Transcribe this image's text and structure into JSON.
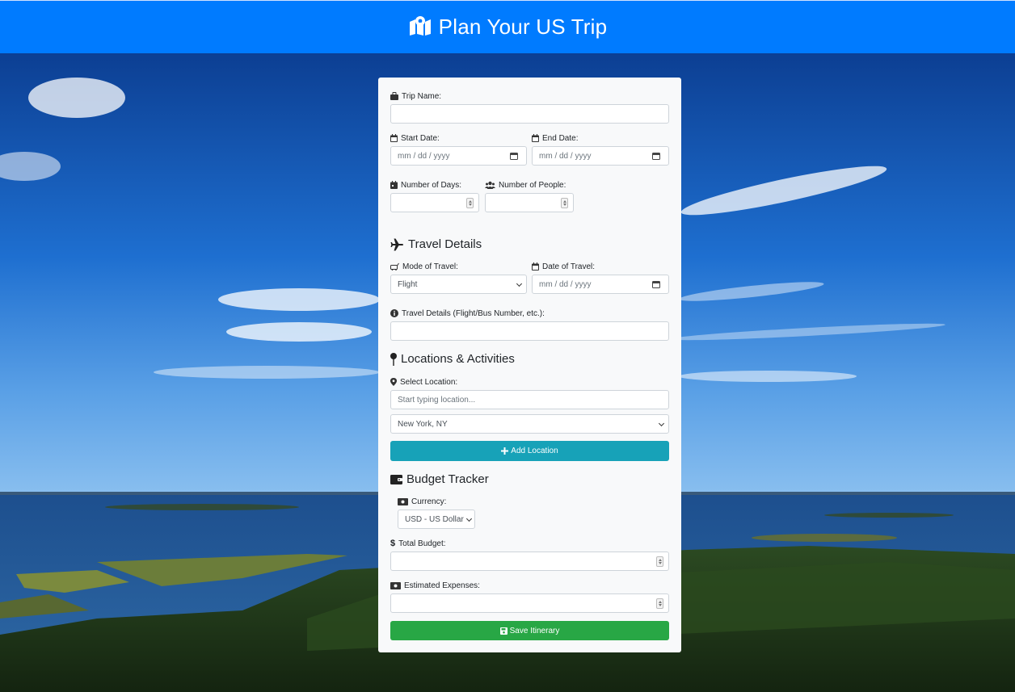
{
  "header": {
    "title": "Plan Your US Trip",
    "icon": "map-marked-icon"
  },
  "form": {
    "trip_name": {
      "label": "Trip Name:",
      "value": ""
    },
    "start_date": {
      "label": "Start Date:",
      "placeholder": "mm / dd / yyyy"
    },
    "end_date": {
      "label": "End Date:",
      "placeholder": "mm / dd / yyyy"
    },
    "num_days": {
      "label": "Number of Days:",
      "value": ""
    },
    "num_people": {
      "label": "Number of People:",
      "value": ""
    }
  },
  "travel": {
    "heading": "Travel Details",
    "mode_label": "Mode of Travel:",
    "mode_value": "Flight",
    "date_label": "Date of Travel:",
    "date_placeholder": "mm / dd / yyyy",
    "details_label": "Travel Details (Flight/Bus Number, etc.):",
    "details_value": ""
  },
  "locations": {
    "heading": "Locations & Activities",
    "select_label": "Select Location:",
    "search_placeholder": "Start typing location...",
    "selected_location": "New York, NY",
    "add_button": "Add Location"
  },
  "budget": {
    "heading": "Budget Tracker",
    "currency_label": "Currency:",
    "currency_value": "USD - US Dollar",
    "total_label": "Total Budget:",
    "total_value": "",
    "expenses_label": "Estimated Expenses:",
    "expenses_value": ""
  },
  "save_button": "Save Itinerary",
  "colors": {
    "header": "#007bff",
    "info": "#17a2b8",
    "success": "#28a745",
    "card": "#f8f9fa"
  }
}
